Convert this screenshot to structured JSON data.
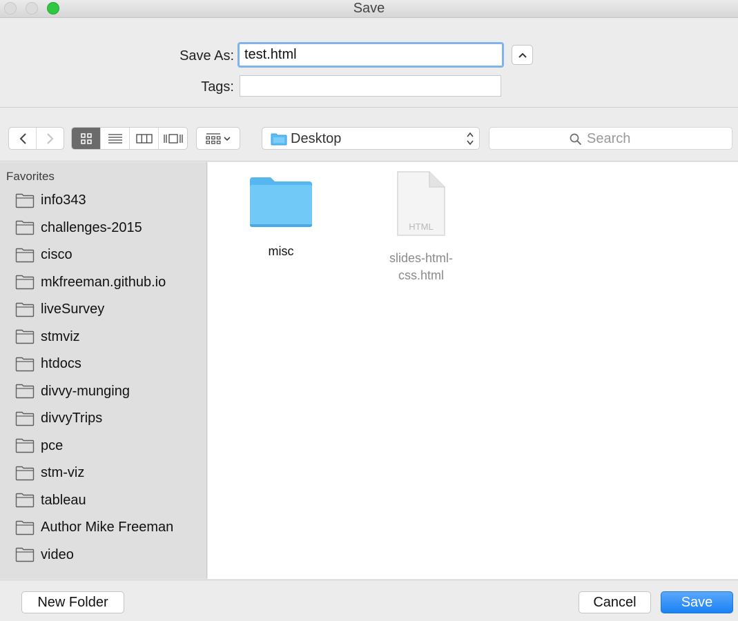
{
  "window": {
    "title": "Save"
  },
  "form": {
    "save_as_label": "Save As:",
    "save_as_value": "test.html",
    "tags_label": "Tags:",
    "tags_value": ""
  },
  "toolbar": {
    "view_modes": [
      "icon-view",
      "list-view",
      "column-view",
      "cover-flow-view"
    ],
    "active_view": "icon-view",
    "location": "Desktop",
    "search_placeholder": "Search"
  },
  "sidebar": {
    "heading": "Favorites",
    "items": [
      {
        "label": "info343"
      },
      {
        "label": "challenges-2015"
      },
      {
        "label": "cisco"
      },
      {
        "label": "mkfreeman.github.io"
      },
      {
        "label": "liveSurvey"
      },
      {
        "label": "stmviz"
      },
      {
        "label": "htdocs"
      },
      {
        "label": "divvy-munging"
      },
      {
        "label": "divvyTrips"
      },
      {
        "label": "pce"
      },
      {
        "label": "stm-viz"
      },
      {
        "label": "tableau"
      },
      {
        "label": "Author Mike Freeman"
      },
      {
        "label": "video"
      }
    ]
  },
  "browser": {
    "items": [
      {
        "name": "misc",
        "kind": "folder"
      },
      {
        "name": "slides-html-css.html",
        "kind": "html-file",
        "name_line1": "slides-html-",
        "name_line2": "css.html",
        "badge": "HTML"
      }
    ]
  },
  "buttons": {
    "new_folder": "New Folder",
    "cancel": "Cancel",
    "save": "Save"
  },
  "colors": {
    "accent": "#1a82f6",
    "folder_blue": "#5bbdf4",
    "focus_ring": "#80b3ec"
  }
}
